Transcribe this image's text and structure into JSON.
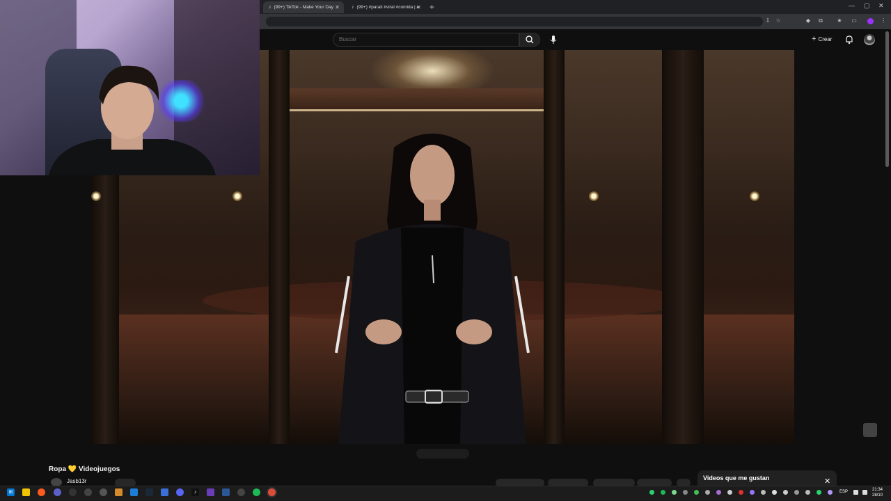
{
  "browser": {
    "tabs": [
      {
        "title": "(99+) TikTok - Make Your Day",
        "active": true
      },
      {
        "title": "(99+) #parati #viral #comida | e",
        "active": false
      }
    ],
    "new_tab_symbol": "+",
    "window_controls": [
      "—",
      "▢",
      "✕"
    ],
    "toolbar_icons": [
      "download-icon",
      "star-icon",
      "extension-icon",
      "puzzle-icon",
      "bookmark-star-icon",
      "profile-icon",
      "menu-icon"
    ]
  },
  "youtube": {
    "search_placeholder": "Buscar",
    "create_label": "Crear",
    "video": {
      "title": "Ropa 💛 Videojuegos",
      "channel": "Jasb13r"
    },
    "liked_panel": {
      "title": "Videos que me gustan",
      "close": "✕"
    }
  },
  "taskbar": {
    "language": "ESP",
    "time": "21:34",
    "date": "28/10",
    "accent": "#0078d4"
  }
}
